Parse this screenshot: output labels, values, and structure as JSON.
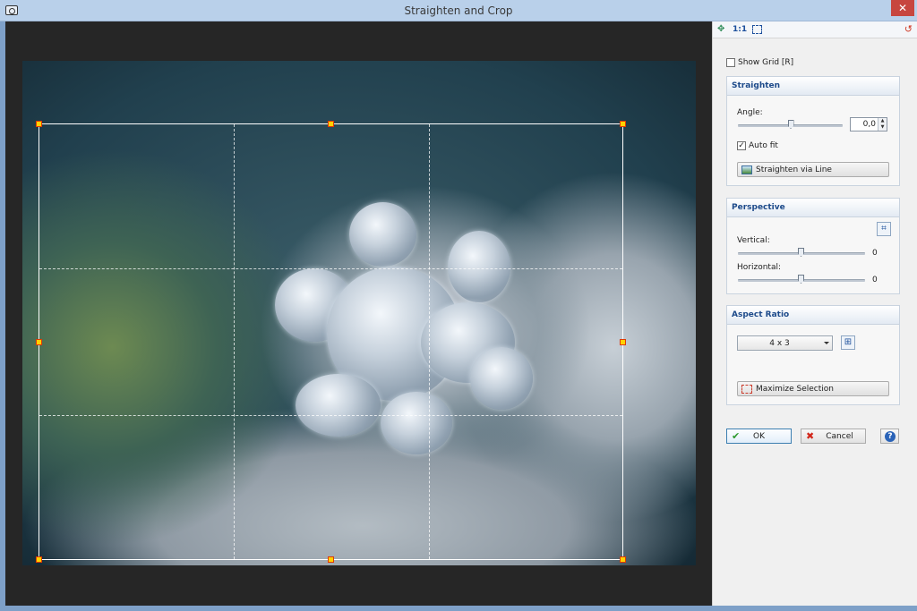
{
  "window": {
    "title": "Straighten and Crop",
    "close_glyph": "✕"
  },
  "panel": {
    "toolbar": {
      "one_to_one": "1:1",
      "nav_glyph": "✥",
      "reset_glyph": "↺"
    },
    "show_grid": {
      "label": "Show Grid  [R]",
      "checked": false
    },
    "straighten": {
      "heading": "Straighten",
      "angle_label": "Angle:",
      "angle_value": "0,0",
      "angle_slider_fraction": 0.5,
      "auto_fit_label": "Auto fit",
      "auto_fit_checked": true,
      "straighten_line_label": "Straighten via Line"
    },
    "perspective": {
      "heading": "Perspective",
      "vertical_label": "Vertical:",
      "vertical_value": "0",
      "horizontal_label": "Horizontal:",
      "horizontal_value": "0"
    },
    "aspect_ratio": {
      "heading": "Aspect Ratio",
      "selected": "4 x 3",
      "maximize_label": "Maximize Selection"
    },
    "actions": {
      "ok_label": "OK",
      "cancel_label": "Cancel",
      "help_glyph": "?"
    }
  },
  "colors": {
    "accent": "#1d4a8a",
    "handle_fill": "#ffd200",
    "handle_border": "#e03a00",
    "close": "#c7463f"
  }
}
